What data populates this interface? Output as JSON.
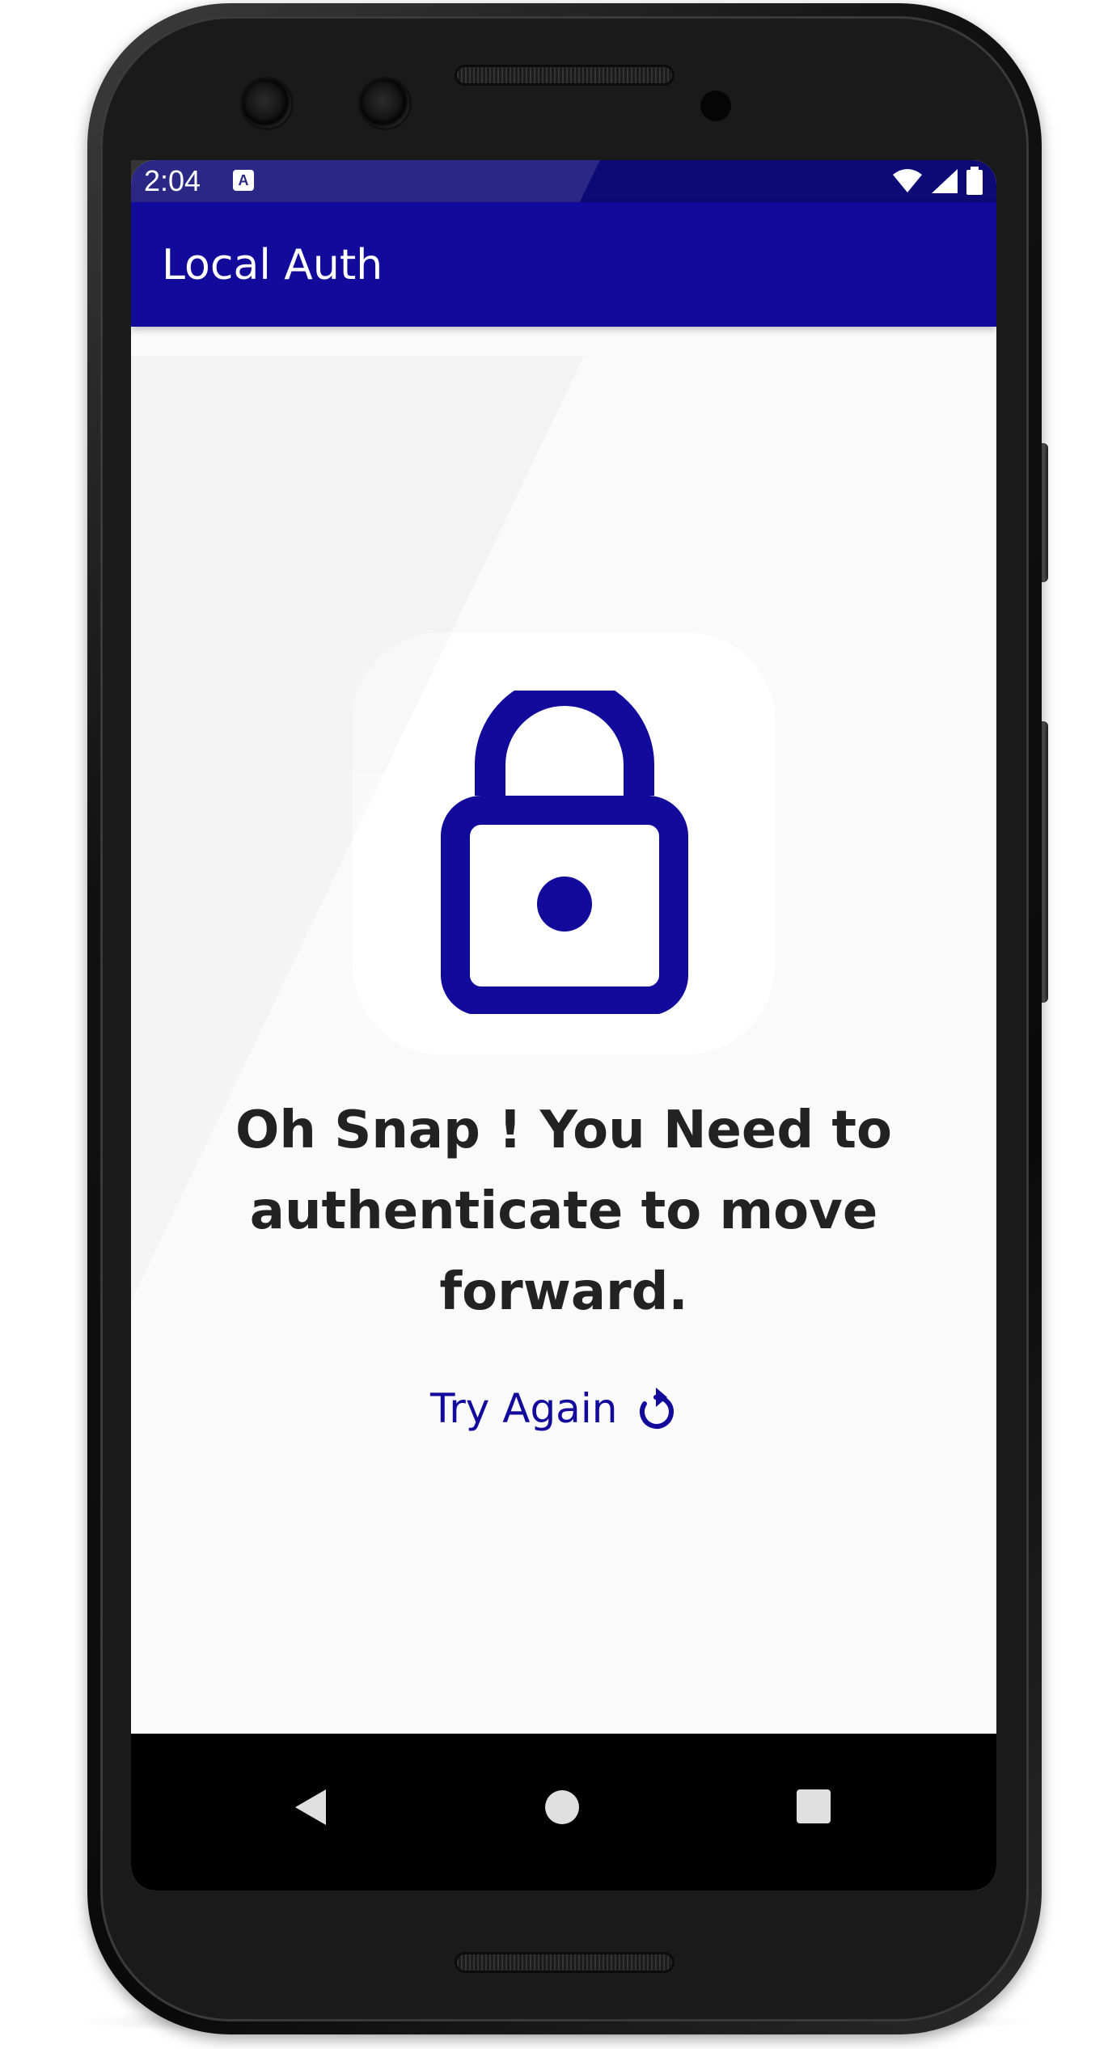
{
  "status_bar": {
    "time": "2:04",
    "notification_icon": "a-icon",
    "icons": [
      "wifi-icon",
      "signal-icon",
      "battery-icon"
    ]
  },
  "app_bar": {
    "title": "Local Auth"
  },
  "main": {
    "icon": "lock-icon",
    "message": "Oh Snap ! You Need to authenticate to move forward.",
    "try_again_label": "Try Again",
    "try_again_icon": "refresh-icon"
  },
  "nav_bar": {
    "buttons": [
      "back-button",
      "home-button",
      "recents-button"
    ]
  },
  "colors": {
    "primary": "#120a9a",
    "status_bar": "#0d0a75",
    "background": "#fafafa",
    "text": "#222222"
  }
}
